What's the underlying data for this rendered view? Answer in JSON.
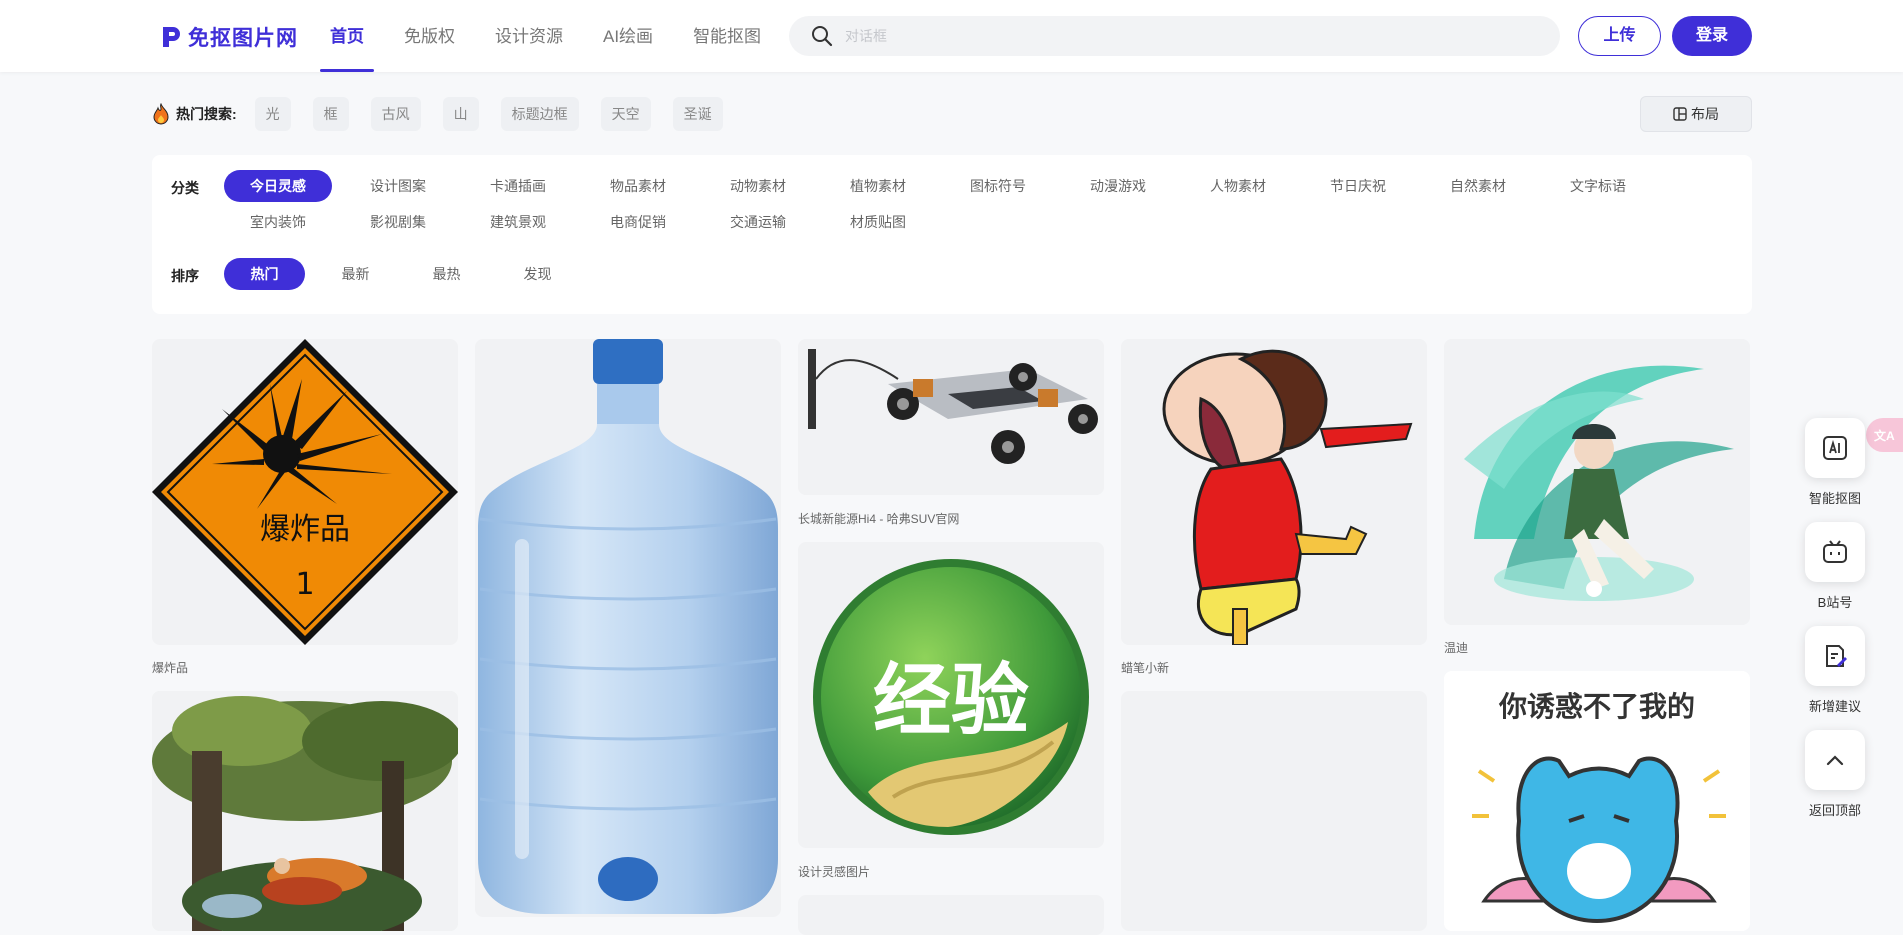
{
  "header": {
    "logo_text": "免抠图片网",
    "nav": [
      "首页",
      "免版权",
      "设计资源",
      "AI绘画",
      "智能抠图"
    ],
    "search_placeholder": "对话框",
    "upload_label": "上传",
    "login_label": "登录"
  },
  "hot_search": {
    "label": "热门搜索:",
    "tags": [
      "光",
      "框",
      "古风",
      "山",
      "标题边框",
      "天空",
      "圣诞"
    ],
    "layout_label": "布局"
  },
  "filters": {
    "category_label": "分类",
    "categories_row1": [
      "今日灵感",
      "设计图案",
      "卡通插画",
      "物品素材",
      "动物素材",
      "植物素材",
      "图标符号",
      "动漫游戏",
      "人物素材",
      "节日庆祝",
      "自然素材",
      "文字标语"
    ],
    "categories_row2": [
      "室内装饰",
      "影视剧集",
      "建筑景观",
      "电商促销",
      "交通运输",
      "材质贴图"
    ],
    "sort_label": "排序",
    "sorts": [
      "热门",
      "最新",
      "最热",
      "发现"
    ]
  },
  "cards": {
    "c1_caption": "爆炸品",
    "c1_sign_text": "爆炸品",
    "c1_sign_num": "1",
    "c3_caption": "长城新能源Hi4 - 哈弗SUV官网",
    "c4_caption": "设计灵感图片",
    "c4_badge_text": "经验",
    "c5_caption": "蜡笔小新",
    "c6_caption": "温迪",
    "c7_text": "你诱惑不了我的"
  },
  "floating": {
    "smart_cutout": "智能抠图",
    "bilibili": "B站号",
    "suggest": "新增建议",
    "back_top": "返回顶部",
    "translate_glyph": "文A"
  },
  "colors": {
    "accent": "#3f2fd8"
  }
}
